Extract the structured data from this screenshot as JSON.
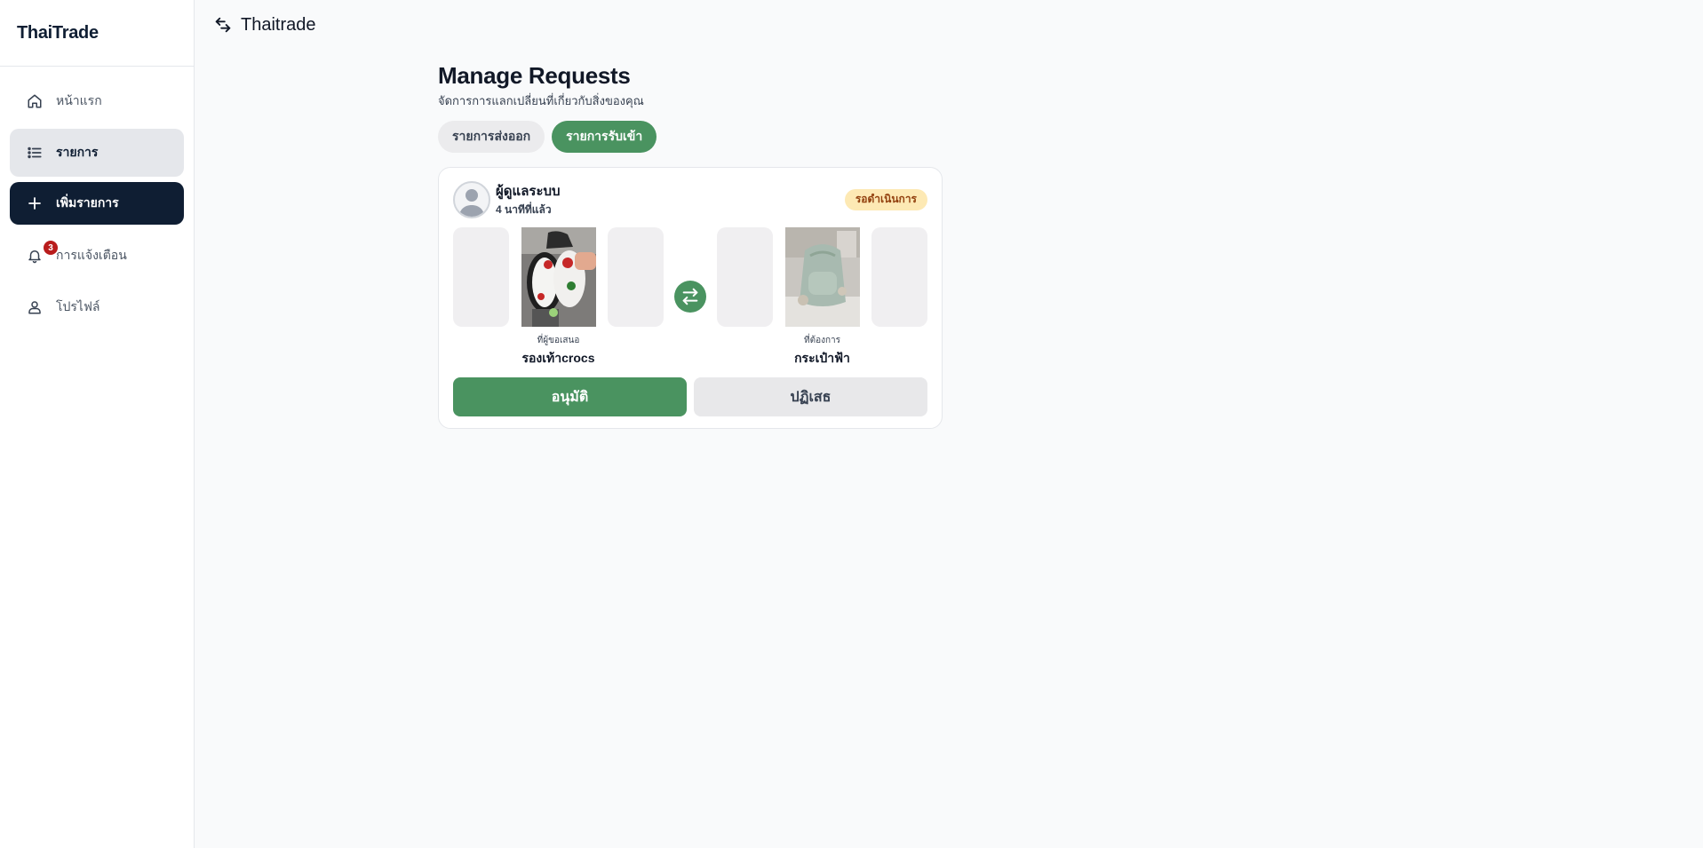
{
  "sidebar": {
    "brand": "ThaiTrade",
    "items": [
      {
        "label": "หน้าแรก",
        "icon": "home-icon"
      },
      {
        "label": "รายการ",
        "icon": "list-icon"
      },
      {
        "label": "เพิ่มรายการ",
        "icon": "plus-icon"
      },
      {
        "label": "การแจ้งเตือน",
        "icon": "bell-icon",
        "badge": "3"
      },
      {
        "label": "โปรไฟล์",
        "icon": "user-icon"
      }
    ]
  },
  "topbar": {
    "title": "Thaitrade",
    "icon": "swap-arrows-icon"
  },
  "main": {
    "title": "Manage Requests",
    "subtitle": "จัดการการแลกเปลี่ยนที่เกี่ยวกับสิ่งของคุณ",
    "tabs": [
      {
        "label": "รายการส่งออก",
        "active": false
      },
      {
        "label": "รายการรับเข้า",
        "active": true
      }
    ],
    "request": {
      "user_name": "ผู้ดูแลระบบ",
      "time_ago": "4 นาทีที่แล้ว",
      "status": "รอดำเนินการ",
      "offered": {
        "caption": "ที่ผู้ขอเสนอ",
        "title": "รองเท้าcrocs"
      },
      "wanted": {
        "caption": "ที่ต้องการ",
        "title": "กระเป๋าฟ้า"
      },
      "approve_label": "อนุมัติ",
      "reject_label": "ปฏิเสธ"
    }
  },
  "colors": {
    "navy": "#0f1e33",
    "green": "#4a9360",
    "status_bg": "#fde9b4",
    "badge_red": "#b91c1c"
  }
}
